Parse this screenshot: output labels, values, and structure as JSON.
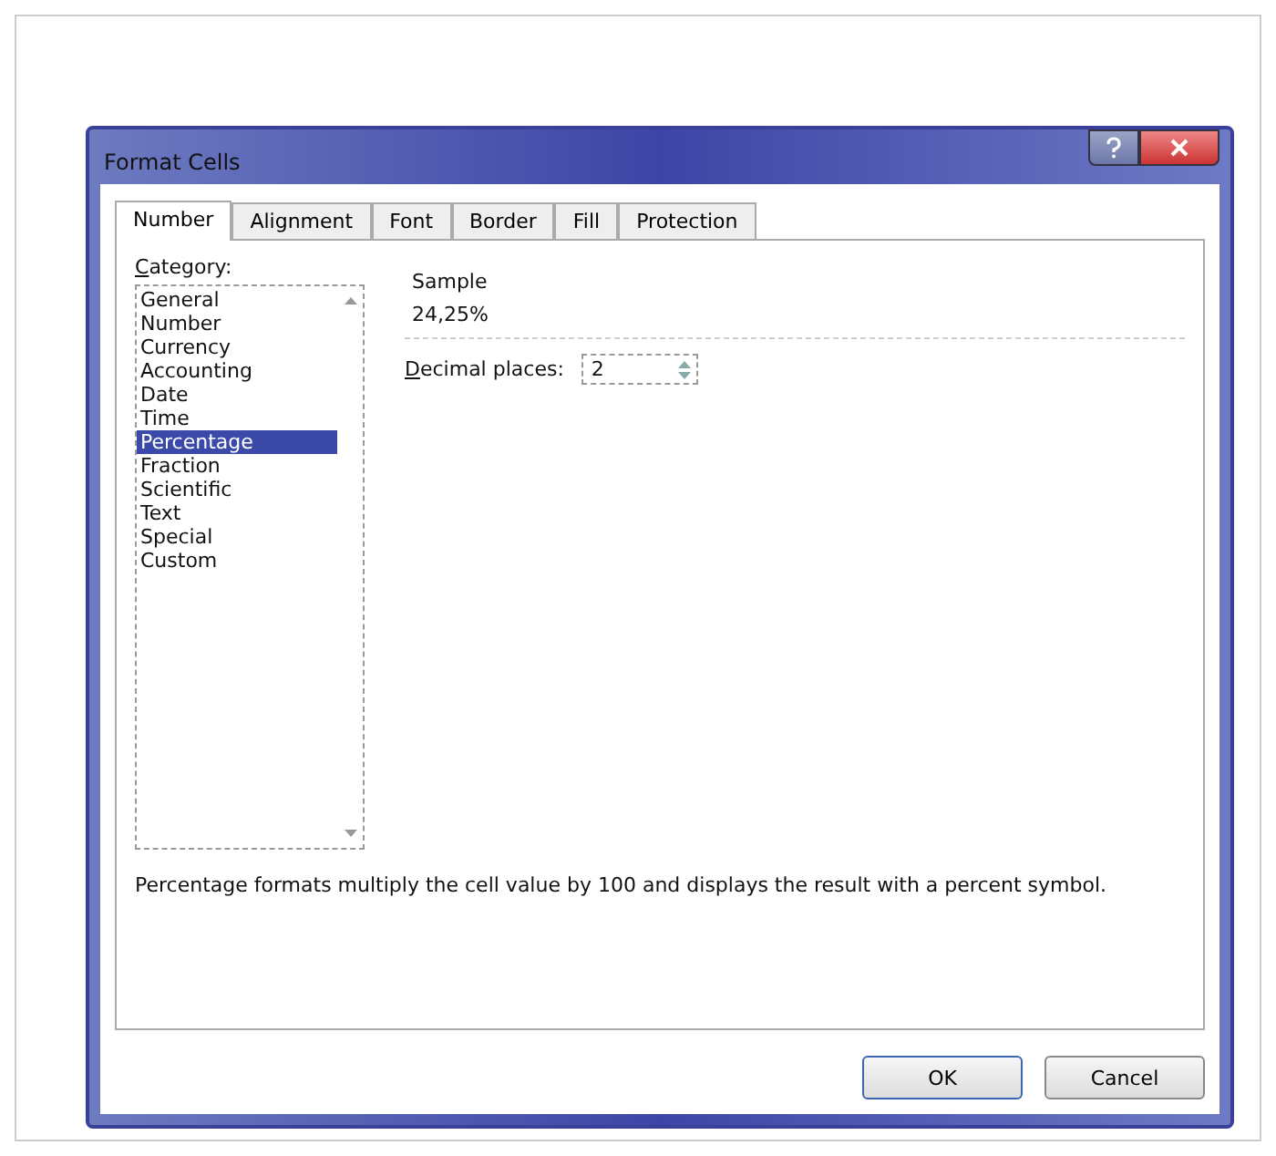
{
  "window": {
    "title": "Format Cells"
  },
  "tabs": [
    {
      "label": "Number",
      "selected": true
    },
    {
      "label": "Alignment",
      "selected": false
    },
    {
      "label": "Font",
      "selected": false
    },
    {
      "label": "Border",
      "selected": false
    },
    {
      "label": "Fill",
      "selected": false
    },
    {
      "label": "Protection",
      "selected": false
    }
  ],
  "category": {
    "label": "Category:",
    "items": [
      {
        "label": "General",
        "selected": false
      },
      {
        "label": "Number",
        "selected": false
      },
      {
        "label": "Currency",
        "selected": false
      },
      {
        "label": "Accounting",
        "selected": false
      },
      {
        "label": "Date",
        "selected": false
      },
      {
        "label": "Time",
        "selected": false
      },
      {
        "label": "Percentage",
        "selected": true
      },
      {
        "label": "Fraction",
        "selected": false
      },
      {
        "label": "Scientific",
        "selected": false
      },
      {
        "label": "Text",
        "selected": false
      },
      {
        "label": "Special",
        "selected": false
      },
      {
        "label": "Custom",
        "selected": false
      }
    ]
  },
  "sample": {
    "label": "Sample",
    "value": "24,25%"
  },
  "decimal_places": {
    "label": "Decimal places:",
    "value": "2"
  },
  "description": "Percentage formats multiply the cell value by 100 and displays the result with a percent symbol.",
  "buttons": [
    {
      "label": "OK",
      "default": true
    },
    {
      "label": "Cancel",
      "default": false
    }
  ]
}
